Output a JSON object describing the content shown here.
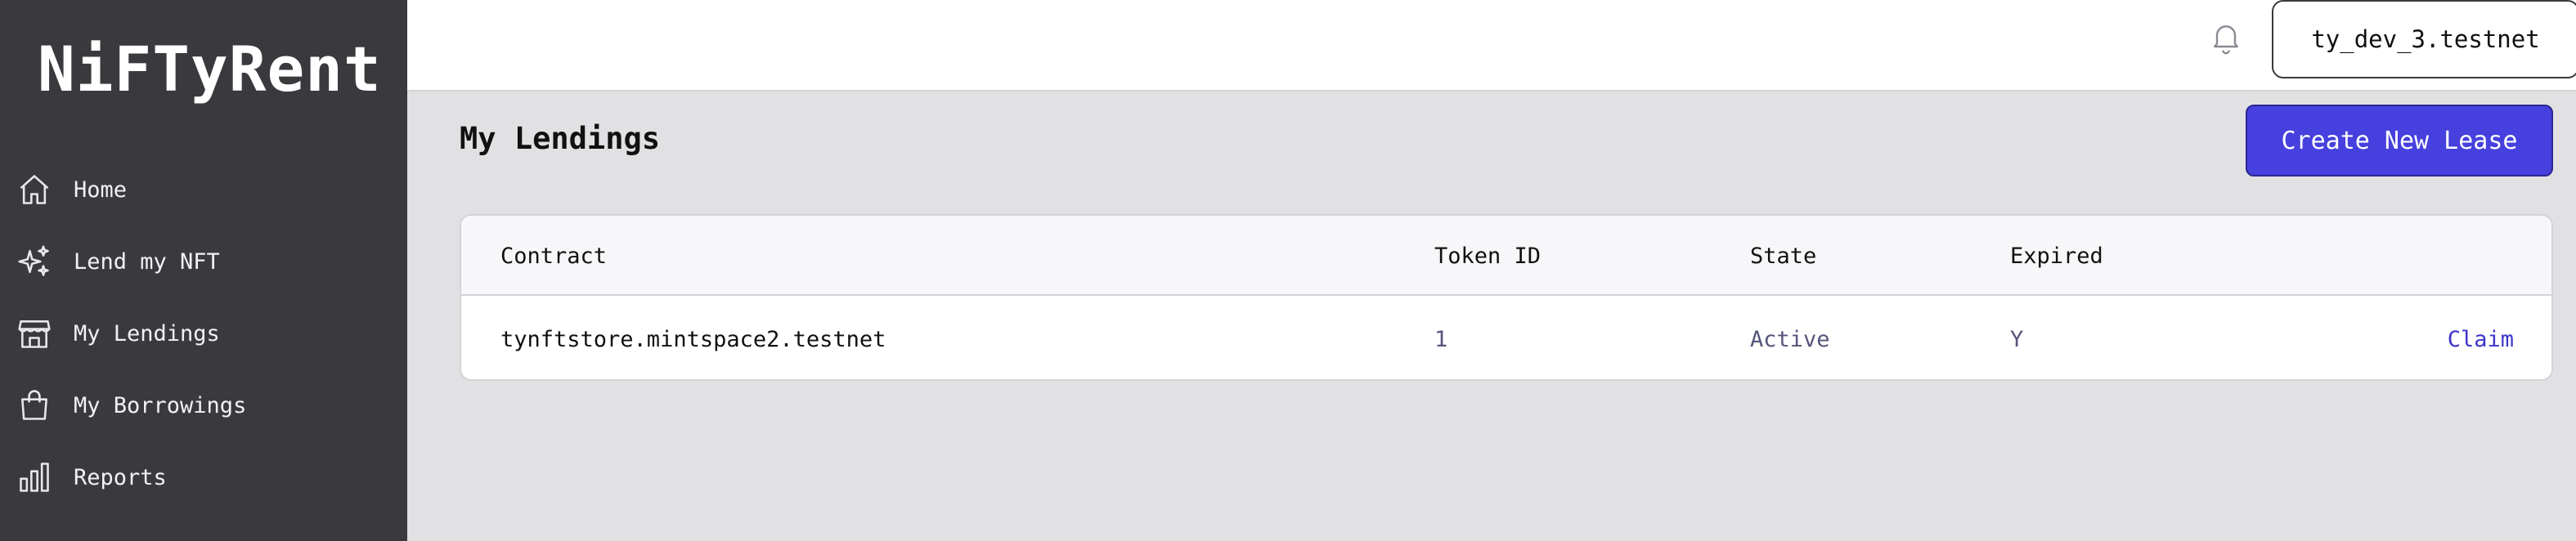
{
  "app": {
    "name": "NiFTyRent"
  },
  "sidebar": {
    "items": [
      {
        "label": "Home",
        "icon": "home-icon"
      },
      {
        "label": "Lend my NFT",
        "icon": "sparkles-icon"
      },
      {
        "label": "My Lendings",
        "icon": "store-icon"
      },
      {
        "label": "My Borrowings",
        "icon": "shopping-bag-icon"
      },
      {
        "label": "Reports",
        "icon": "bar-chart-icon"
      }
    ]
  },
  "header": {
    "notifications_icon": "bell-icon",
    "account_label": "ty_dev_3.testnet"
  },
  "main": {
    "title": "My Lendings",
    "create_button_label": "Create New Lease",
    "table": {
      "columns": [
        "Contract",
        "Token ID",
        "State",
        "Expired"
      ],
      "rows": [
        {
          "contract": "tynftstore.mintspace2.testnet",
          "token_id": "1",
          "state": "Active",
          "expired": "Y",
          "action": "Claim"
        }
      ]
    }
  },
  "colors": {
    "sidebar_bg": "#3a3a3e",
    "accent": "#4640de",
    "page_bg": "#e1e1e3",
    "muted_text": "#55557a"
  }
}
